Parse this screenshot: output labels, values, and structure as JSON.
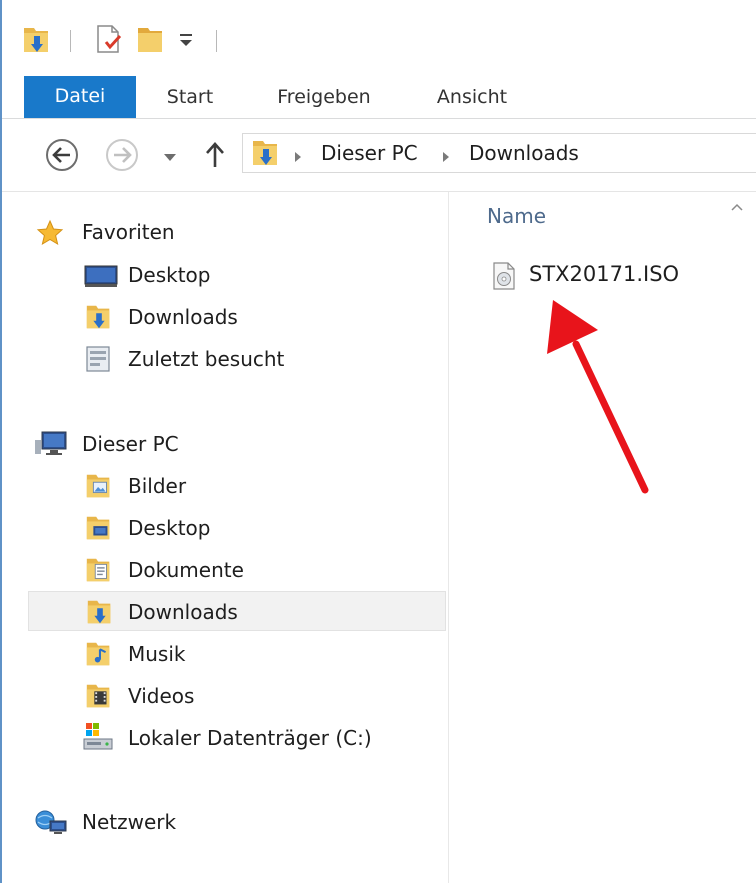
{
  "ribbon": {
    "tabs": [
      {
        "label": "Datei"
      },
      {
        "label": "Start"
      },
      {
        "label": "Freigeben"
      },
      {
        "label": "Ansicht"
      }
    ]
  },
  "address": {
    "crumbs": [
      "Dieser PC",
      "Downloads"
    ]
  },
  "navigation": {
    "favorites": {
      "label": "Favoriten",
      "items": [
        "Desktop",
        "Downloads",
        "Zuletzt besucht"
      ]
    },
    "this_pc": {
      "label": "Dieser PC",
      "items": [
        "Bilder",
        "Desktop",
        "Dokumente",
        "Downloads",
        "Musik",
        "Videos",
        "Lokaler Datenträger (C:)"
      ],
      "selected": "Downloads"
    },
    "network": {
      "label": "Netzwerk"
    }
  },
  "content": {
    "column_header": "Name",
    "files": [
      {
        "name": "STX20171.ISO",
        "icon": "iso-file-icon"
      }
    ]
  },
  "colors": {
    "file_tab": "#1979ca",
    "window_border": "#5f92c7",
    "selection": "#f2f2f2",
    "annotation_arrow": "#e8141b"
  }
}
